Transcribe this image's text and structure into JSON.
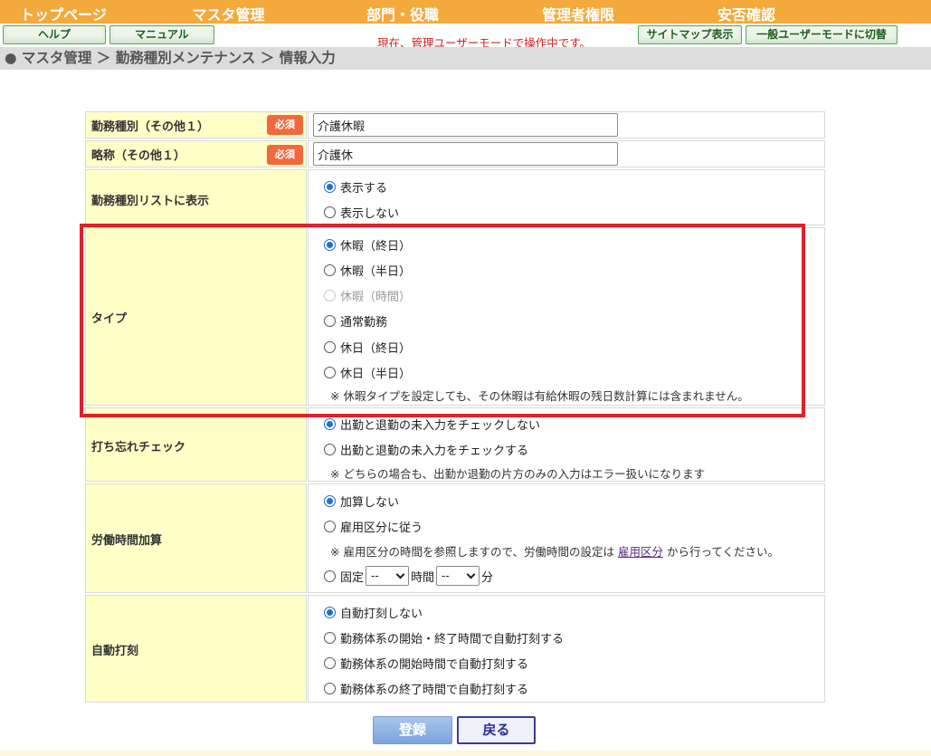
{
  "nav": {
    "items": [
      "トップページ",
      "マスタ管理",
      "部門・役職",
      "管理者権限",
      "安否確認"
    ]
  },
  "toolbar": {
    "help": "ヘルプ",
    "manual": "マニュアル",
    "mode_text": "現在、管理ユーザーモードで操作中です。",
    "sitemap": "サイトマップ表示",
    "switch_mode": "一般ユーザーモードに切替"
  },
  "breadcrumb": "● マスタ管理 ＞ 勤務種別メンテナンス ＞ 情報入力",
  "form": {
    "required_badge": "必須",
    "name": {
      "label": "勤務種別（その他１）",
      "value": "介護休暇"
    },
    "abbr": {
      "label": "略称（その他１）",
      "value": "介護休"
    },
    "list_display": {
      "label": "勤務種別リストに表示",
      "options": [
        "表示する",
        "表示しない"
      ],
      "selected": 0
    },
    "type": {
      "label": "タイプ",
      "options": [
        "休暇（終日）",
        "休暇（半日）",
        "休暇（時間）",
        "通常勤務",
        "休日（終日）",
        "休日（半日）"
      ],
      "selected": 0,
      "disabled": [
        2
      ],
      "note": "※ 休暇タイプを設定しても、その休暇は有給休暇の残日数計算には含まれません。"
    },
    "forget_check": {
      "label": "打ち忘れチェック",
      "options": [
        "出勤と退勤の未入力をチェックしない",
        "出勤と退勤の未入力をチェックする"
      ],
      "selected": 0,
      "note": "※ どちらの場合も、出勤か退勤の片方のみの入力はエラー扱いになります"
    },
    "labor_time": {
      "label": "労働時間加算",
      "options": [
        "加算しない",
        "雇用区分に従う",
        "固定"
      ],
      "selected": 0,
      "note_prefix": "※ 雇用区分の時間を参照しますので、労働時間の設定は",
      "note_link": "雇用区分",
      "note_suffix": "から行ってください。",
      "hour_value": "--",
      "hour_unit": "時間",
      "minute_value": "--",
      "minute_unit": "分"
    },
    "auto_stamp": {
      "label": "自動打刻",
      "options": [
        "自動打刻しない",
        "勤務体系の開始・終了時間で自動打刻する",
        "勤務体系の開始時間で自動打刻する",
        "勤務体系の終了時間で自動打刻する"
      ],
      "selected": 0
    }
  },
  "buttons": {
    "submit": "登録",
    "back": "戻る"
  },
  "colors": {
    "nav": "#f4a93c",
    "label_bg": "#ffffc8",
    "highlight": "#e0202a",
    "mode_text": "#d11e1e"
  }
}
